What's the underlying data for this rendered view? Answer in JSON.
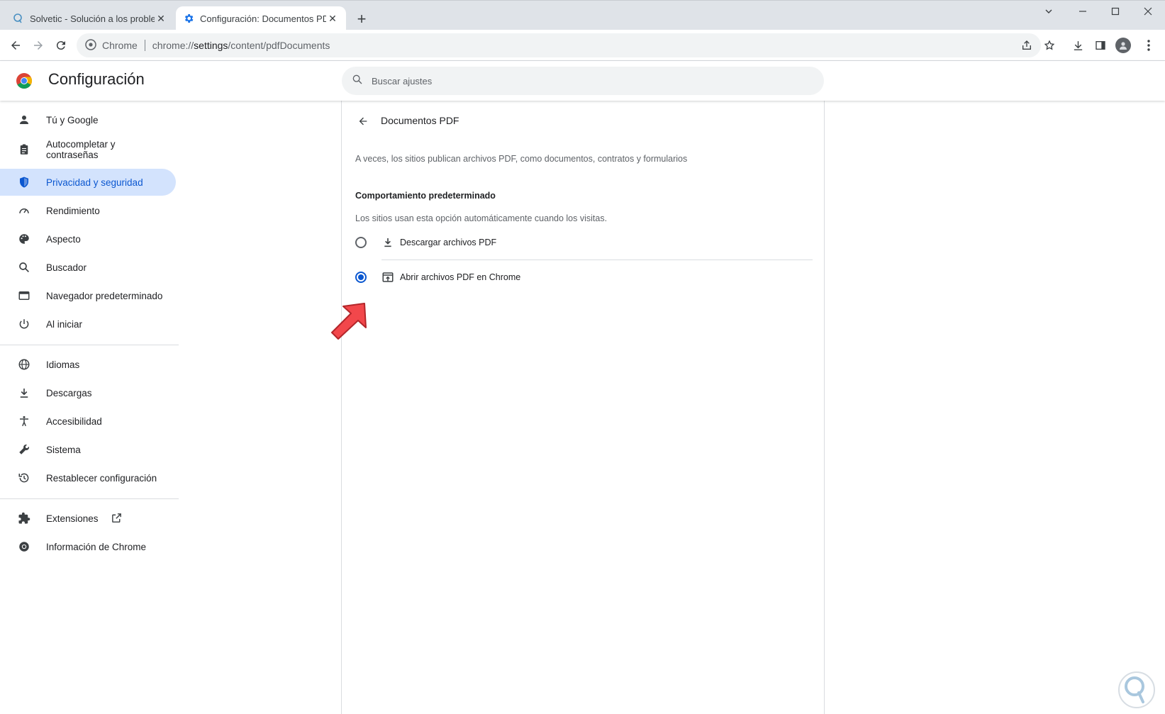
{
  "tabs": [
    {
      "title": "Solvetic - Solución a los problemas",
      "active": false
    },
    {
      "title": "Configuración: Documentos PDF",
      "active": true
    }
  ],
  "toolbar": {
    "site_chip": "Chrome",
    "url_prefix": "chrome://",
    "url_host": "settings",
    "url_path": "/content/pdfDocuments"
  },
  "header": {
    "title": "Configuración",
    "search_placeholder": "Buscar ajustes"
  },
  "sidebar": {
    "items": [
      {
        "label": "Tú y Google",
        "icon": "person-icon"
      },
      {
        "label": "Autocompletar y contraseñas",
        "icon": "clipboard-icon"
      },
      {
        "label": "Privacidad y seguridad",
        "icon": "shield-icon",
        "selected": true
      },
      {
        "label": "Rendimiento",
        "icon": "speedometer-icon"
      },
      {
        "label": "Aspecto",
        "icon": "palette-icon"
      },
      {
        "label": "Buscador",
        "icon": "search-icon"
      },
      {
        "label": "Navegador predeterminado",
        "icon": "browser-icon"
      },
      {
        "label": "Al iniciar",
        "icon": "power-icon"
      },
      {
        "label": "Idiomas",
        "icon": "globe-icon"
      },
      {
        "label": "Descargas",
        "icon": "download-icon"
      },
      {
        "label": "Accesibilidad",
        "icon": "accessibility-icon"
      },
      {
        "label": "Sistema",
        "icon": "wrench-icon"
      },
      {
        "label": "Restablecer configuración",
        "icon": "history-icon"
      },
      {
        "label": "Extensiones",
        "icon": "puzzle-icon"
      },
      {
        "label": "Información de Chrome",
        "icon": "chrome-icon"
      }
    ]
  },
  "main": {
    "page_title": "Documentos PDF",
    "description": "A veces, los sitios publican archivos PDF, como documentos, contratos y formularios",
    "section_heading": "Comportamiento predeterminado",
    "section_sub": "Los sitios usan esta opción automáticamente cuando los visitas.",
    "options": [
      {
        "label": "Descargar archivos PDF",
        "icon": "download-icon",
        "checked": false
      },
      {
        "label": "Abrir archivos PDF en Chrome",
        "icon": "open-in-browser-icon",
        "checked": true
      }
    ]
  },
  "colors": {
    "accent": "#0b57d0",
    "selected_bg": "#d3e3fd",
    "annotation_arrow": "#f2474b"
  }
}
